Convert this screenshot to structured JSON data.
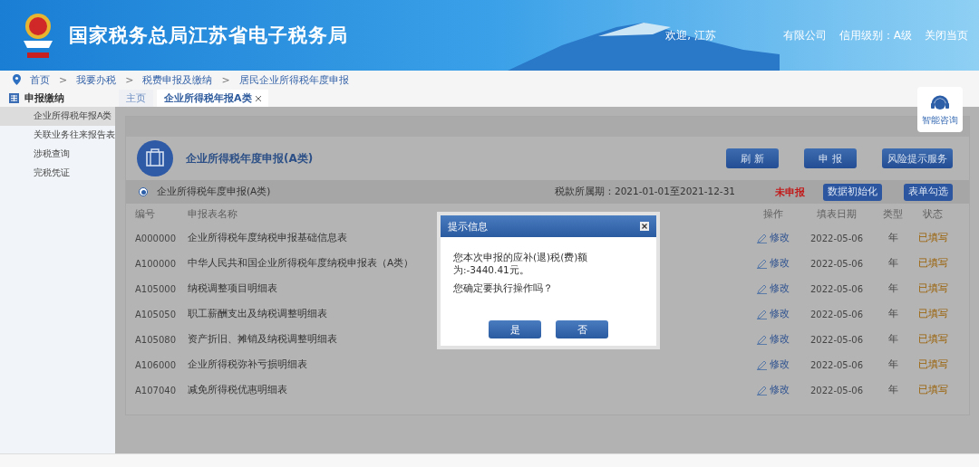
{
  "header": {
    "title": "国家税务总局江苏省电子税务局",
    "welcome_left": "欢迎, 江苏",
    "welcome_right": "有限公司",
    "credit": "信用级别：A级",
    "close": "关闭当页"
  },
  "breadcrumb": {
    "separator": ">",
    "items": [
      "首页",
      "我要办税",
      "税费申报及缴纳",
      "居民企业所得税年度申报"
    ]
  },
  "sidebar": {
    "title": "申报缴纳",
    "items": [
      {
        "label": "企业所得税年报A类",
        "selected": true
      },
      {
        "label": "关联业务往来报告表",
        "selected": false
      },
      {
        "label": "涉税查询",
        "selected": false
      },
      {
        "label": "完税凭证",
        "selected": false
      }
    ]
  },
  "tabs": [
    {
      "label": "主页",
      "selected": false,
      "closable": false
    },
    {
      "label": "企业所得税年报A类",
      "selected": true,
      "closable": true
    }
  ],
  "consult": {
    "label": "智能咨询"
  },
  "form": {
    "title": "企业所得税年度申报(A类)",
    "buttons": [
      "刷 新",
      "申 报",
      "风险提示服务"
    ],
    "option": {
      "label": "企业所得税年度申报(A类)",
      "selected": true
    },
    "period": "税款所属期：2021-01-01至2021-12-31",
    "status": "未申报",
    "small_buttons": [
      "数据初始化",
      "表单勾选"
    ],
    "columns": [
      "编号",
      "申报表名称",
      "操作",
      "填表日期",
      "类型",
      "状态"
    ],
    "rows": [
      {
        "code": "A000000",
        "name": "企业所得税年度纳税申报基础信息表",
        "action": "修改",
        "date": "2022-05-06",
        "type": "年",
        "status": "已填写"
      },
      {
        "code": "A100000",
        "name": "中华人民共和国企业所得税年度纳税申报表（A类）",
        "action": "修改",
        "date": "2022-05-06",
        "type": "年",
        "status": "已填写"
      },
      {
        "code": "A105000",
        "name": "纳税调整项目明细表",
        "action": "修改",
        "date": "2022-05-06",
        "type": "年",
        "status": "已填写"
      },
      {
        "code": "A105050",
        "name": "职工薪酬支出及纳税调整明细表",
        "action": "修改",
        "date": "2022-05-06",
        "type": "年",
        "status": "已填写"
      },
      {
        "code": "A105080",
        "name": "资产折旧、摊销及纳税调整明细表",
        "action": "修改",
        "date": "2022-05-06",
        "type": "年",
        "status": "已填写"
      },
      {
        "code": "A106000",
        "name": "企业所得税弥补亏损明细表",
        "action": "修改",
        "date": "2022-05-06",
        "type": "年",
        "status": "已填写"
      },
      {
        "code": "A107040",
        "name": "减免所得税优惠明细表",
        "action": "修改",
        "date": "2022-05-06",
        "type": "年",
        "status": "已填写"
      }
    ]
  },
  "dialog": {
    "title": "提示信息",
    "lines": [
      "您本次申报的应补(退)税(费)额为:-3440.41元。",
      "您确定要执行操作吗？"
    ],
    "buttons": [
      "是",
      "否"
    ]
  }
}
